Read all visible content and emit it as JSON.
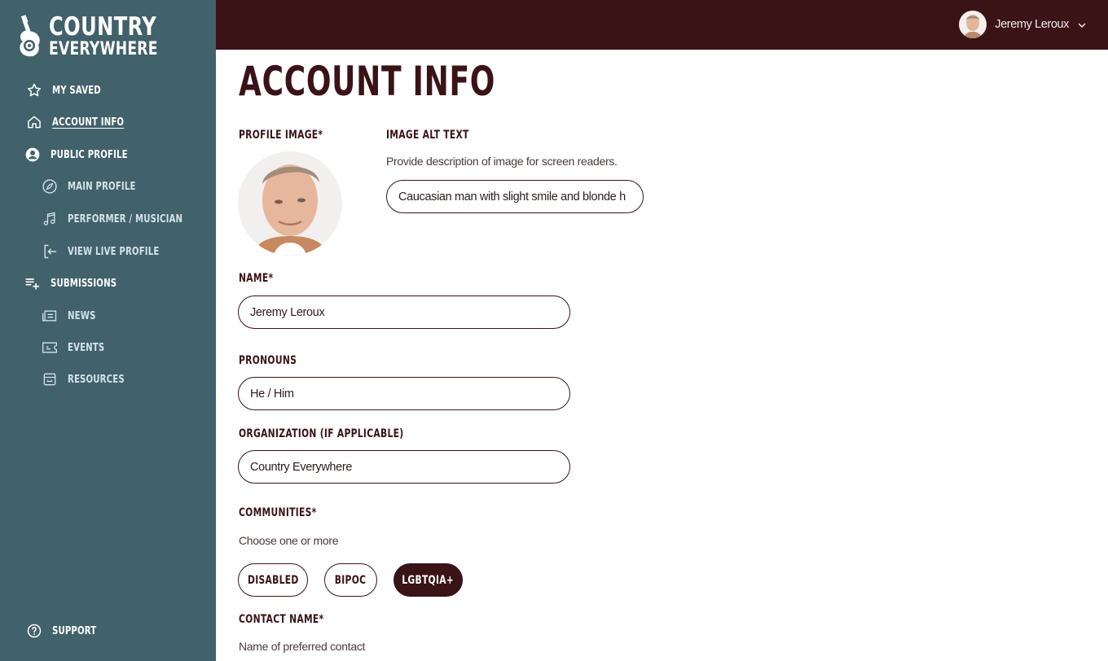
{
  "brand": {
    "name_line1": "COUNTRY",
    "name_line2": "EVERYWHERE",
    "sidebar_color": "#41616b",
    "header_color": "#3a1316",
    "accent_color": "#3a1316"
  },
  "sidebar": {
    "items": [
      {
        "label": "MY SAVED",
        "icon": "star-icon",
        "level": 0,
        "active": false
      },
      {
        "label": "ACCOUNT INFO",
        "icon": "home-icon",
        "level": 0,
        "active": true
      },
      {
        "label": "PUBLIC PROFILE",
        "icon": "user-circle-icon",
        "level": 0,
        "active": false
      },
      {
        "label": "MAIN PROFILE",
        "icon": "compass-icon",
        "level": 1,
        "active": false
      },
      {
        "label": "PERFORMER / MUSICIAN",
        "icon": "music-note-icon",
        "level": 1,
        "active": false
      },
      {
        "label": "VIEW LIVE PROFILE",
        "icon": "enter-icon",
        "level": 1,
        "active": false
      },
      {
        "label": "SUBMISSIONS",
        "icon": "playlist-add-icon",
        "level": 0,
        "active": false
      },
      {
        "label": "NEWS",
        "icon": "newspaper-icon",
        "level": 1,
        "active": false
      },
      {
        "label": "EVENTS",
        "icon": "ticket-icon",
        "level": 1,
        "active": false
      },
      {
        "label": "RESOURCES",
        "icon": "archive-icon",
        "level": 1,
        "active": false
      }
    ],
    "support": {
      "label": "SUPPORT",
      "icon": "help-circle-icon"
    }
  },
  "header": {
    "user_name": "Jeremy Leroux",
    "menu_icon": "chevron-down-icon"
  },
  "main": {
    "title": "ACCOUNT INFO",
    "profile_image_label": "PROFILE IMAGE*",
    "image_alt": {
      "label": "IMAGE ALT TEXT",
      "helper": "Provide description of image for screen readers.",
      "value": "Caucasian man with slight smile and blonde h"
    },
    "name": {
      "label": "NAME*",
      "value": "Jeremy Leroux"
    },
    "pronouns": {
      "label": "PRONOUNS",
      "value": "He / Him"
    },
    "organization": {
      "label": "ORGANIZATION (IF APPLICABLE)",
      "value": "Country Everywhere"
    },
    "communities": {
      "label": "COMMUNITIES*",
      "helper": "Choose one or more",
      "options": [
        {
          "label": "DISABLED",
          "selected": false
        },
        {
          "label": "BIPOC",
          "selected": false
        },
        {
          "label": "LGBTQIA+",
          "selected": true
        }
      ]
    },
    "contact_name": {
      "label": "CONTACT NAME*",
      "helper": "Name of preferred contact"
    }
  }
}
